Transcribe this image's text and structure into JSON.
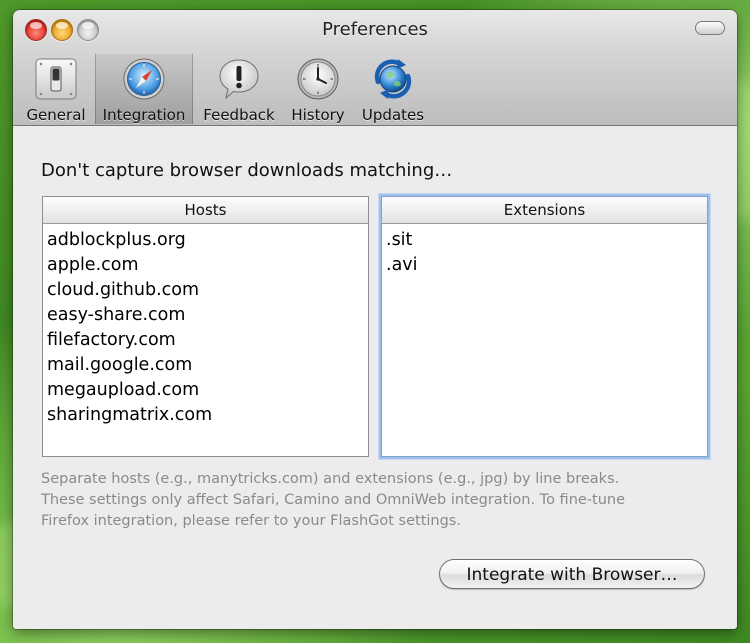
{
  "window": {
    "title": "Preferences"
  },
  "toolbar": {
    "items": [
      {
        "label": "General",
        "icon": "switch-icon"
      },
      {
        "label": "Integration",
        "icon": "compass-icon",
        "selected": true
      },
      {
        "label": "Feedback",
        "icon": "exclamation-bubble-icon"
      },
      {
        "label": "History",
        "icon": "clock-icon"
      },
      {
        "label": "Updates",
        "icon": "globe-arrows-icon"
      }
    ]
  },
  "main": {
    "heading": "Don't capture browser downloads matching…",
    "hosts": {
      "header": "Hosts",
      "items": [
        "adblockplus.org",
        "apple.com",
        "cloud.github.com",
        "easy-share.com",
        "filefactory.com",
        "mail.google.com",
        "megaupload.com",
        "sharingmatrix.com"
      ]
    },
    "extensions": {
      "header": "Extensions",
      "items": [
        ".sit",
        ".avi"
      ]
    },
    "help_lines": [
      "Separate hosts (e.g., manytricks.com) and extensions (e.g., jpg) by line breaks.",
      "These settings only affect Safari, Camino and OmniWeb integration. To fine-tune",
      "Firefox integration, please refer to your FlashGot settings."
    ],
    "integrate_button": "Integrate with Browser…"
  },
  "colors": {
    "focus_ring": "#9ec0ea",
    "help_text": "#8a8a8a",
    "desktop_green": "#4f9a2a"
  }
}
